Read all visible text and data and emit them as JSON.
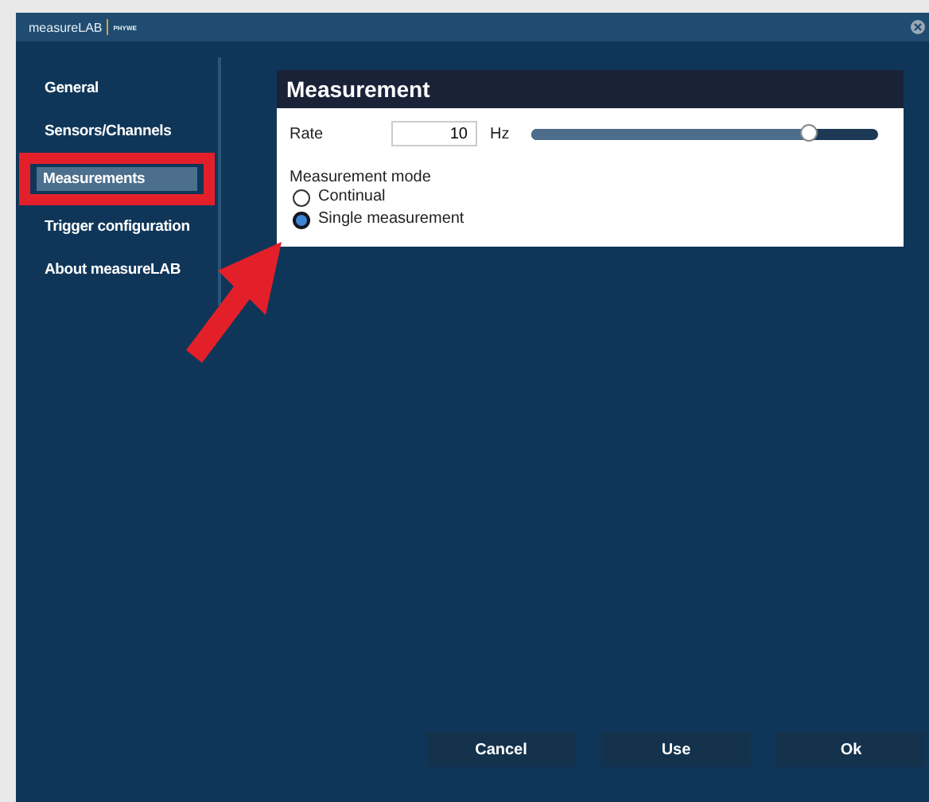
{
  "window": {
    "logo": "measureLAB",
    "brand": "PHYWE"
  },
  "sidebar": {
    "items": [
      {
        "label": "General",
        "selected": false,
        "highlighted": false
      },
      {
        "label": "Sensors/Channels",
        "selected": false,
        "highlighted": false
      },
      {
        "label": "Measurements",
        "selected": true,
        "highlighted": true
      },
      {
        "label": "Trigger configuration",
        "selected": false,
        "highlighted": false
      },
      {
        "label": "About measureLAB",
        "selected": false,
        "highlighted": false
      }
    ]
  },
  "panel": {
    "title": "Measurement",
    "rate": {
      "label": "Rate",
      "value": "10",
      "unit": "Hz",
      "level": 0.8
    },
    "mode": {
      "label": "Measurement mode",
      "options": [
        {
          "label": "Continual",
          "selected": false
        },
        {
          "label": "Single measurement",
          "selected": true
        }
      ]
    }
  },
  "annotation_arrow": true,
  "buttons": [
    "Cancel",
    "Use",
    "Ok"
  ]
}
